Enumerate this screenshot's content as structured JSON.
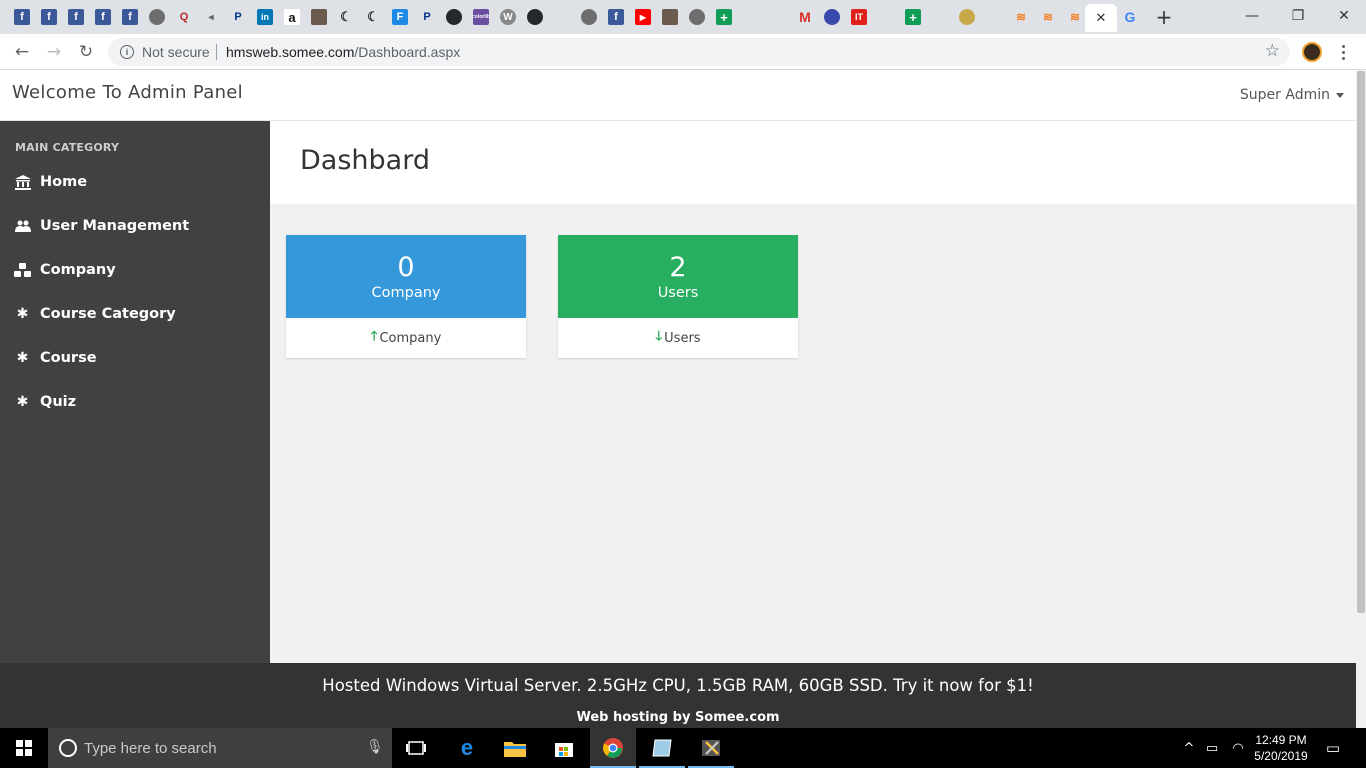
{
  "browser": {
    "address": {
      "security_label": "Not secure",
      "host": "hmsweb.somee.com",
      "path": "/Dashboard.aspx"
    },
    "close_tab_label": "✕",
    "new_tab_label": "+"
  },
  "header": {
    "brand": "Welcome To Admin Panel",
    "user": "Super Admin"
  },
  "sidebar": {
    "category": "MAIN CATEGORY",
    "items": [
      {
        "label": "Home",
        "icon": "bank-icon"
      },
      {
        "label": "User Management",
        "icon": "users-icon"
      },
      {
        "label": "Company",
        "icon": "cubes-icon"
      },
      {
        "label": "Course Category",
        "icon": "gear-icon"
      },
      {
        "label": "Course",
        "icon": "gear-icon"
      },
      {
        "label": "Quiz",
        "icon": "gear-icon"
      }
    ]
  },
  "main": {
    "title": "Dashbard",
    "cards": [
      {
        "count": "0",
        "label": "Company",
        "footer": "Company",
        "arrow": "up",
        "color": "#3498db"
      },
      {
        "count": "2",
        "label": "Users",
        "footer": "Users",
        "arrow": "down",
        "color": "#27ae60"
      }
    ]
  },
  "footer": {
    "ad": "Hosted Windows Virtual Server. 2.5GHz CPU, 1.5GB RAM, 60GB SSD. Try it now for $1!",
    "sub": "Web hosting by Somee.com"
  },
  "taskbar": {
    "search_placeholder": "Type here to search",
    "time": "12:49 PM",
    "date": "5/20/2019"
  }
}
